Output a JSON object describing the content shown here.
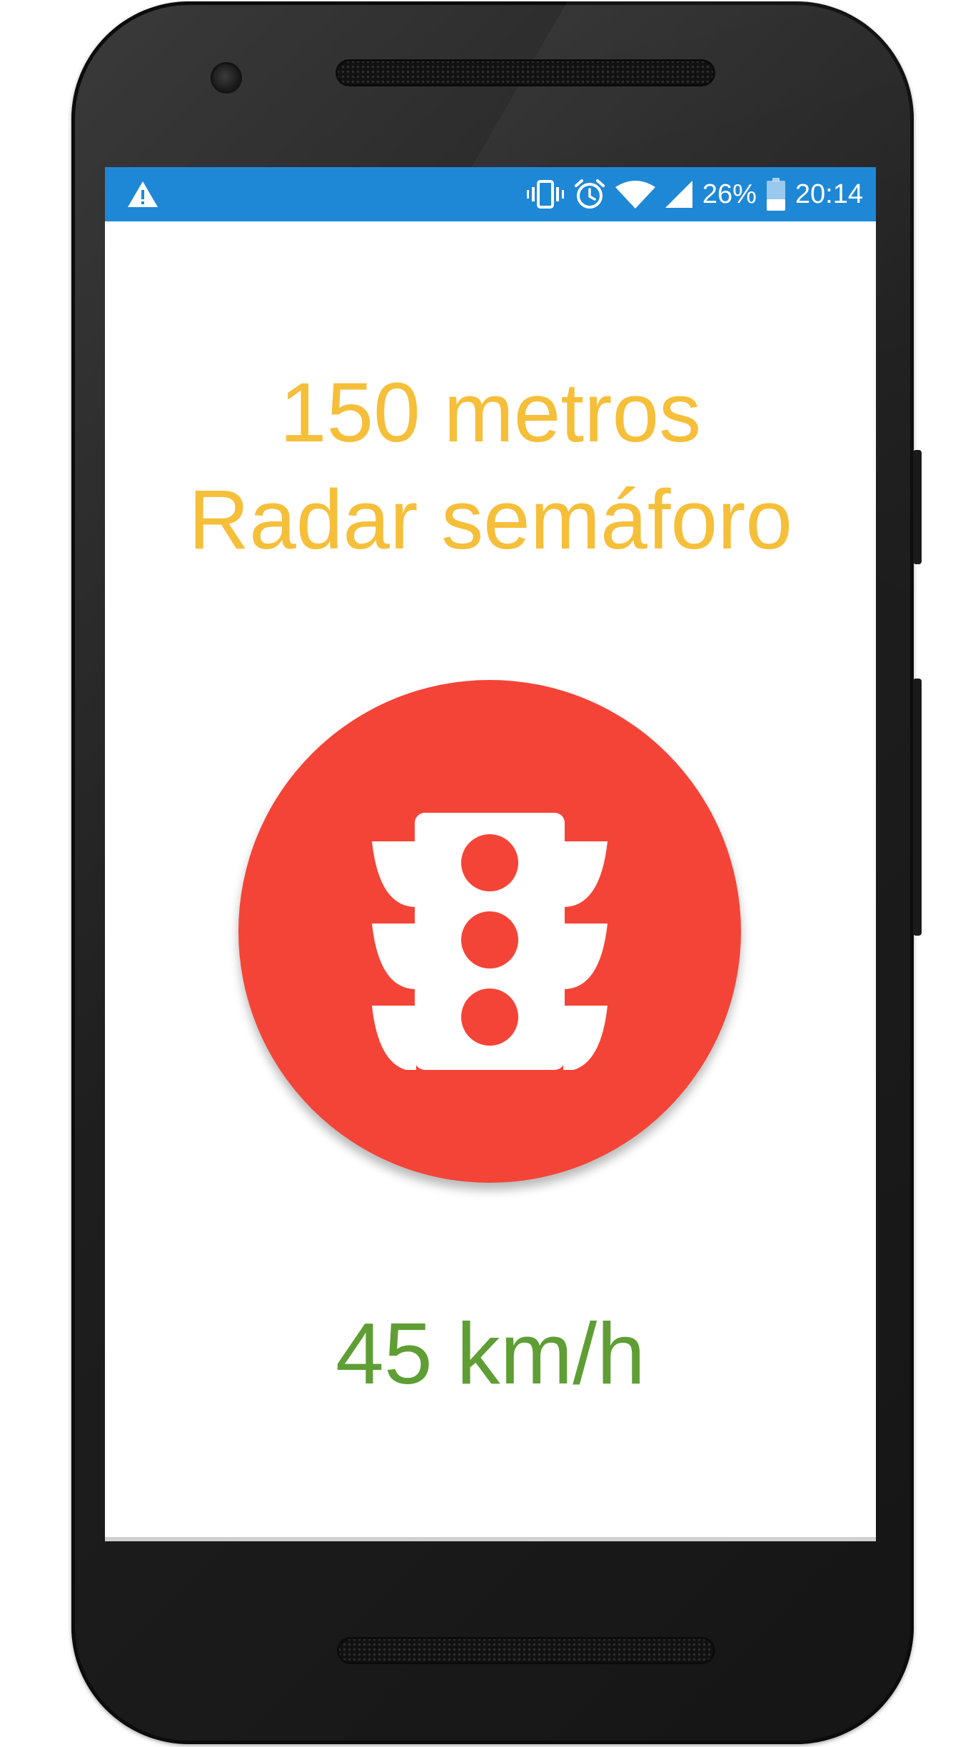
{
  "status_bar": {
    "battery_percent": "26%",
    "time": "20:14",
    "icons": [
      "warning-icon",
      "vibrate-icon",
      "alarm-icon",
      "wifi-icon",
      "signal-icon",
      "battery-icon"
    ]
  },
  "alert": {
    "distance": "150 metros",
    "type": "Radar semáforo",
    "icon": "traffic-light-icon",
    "speed": "45 km/h"
  },
  "colors": {
    "status_bar": "#1e88d6",
    "alert_text": "#f6bf3a",
    "alert_circle": "#f44437",
    "speed_text": "#5f9e35"
  }
}
